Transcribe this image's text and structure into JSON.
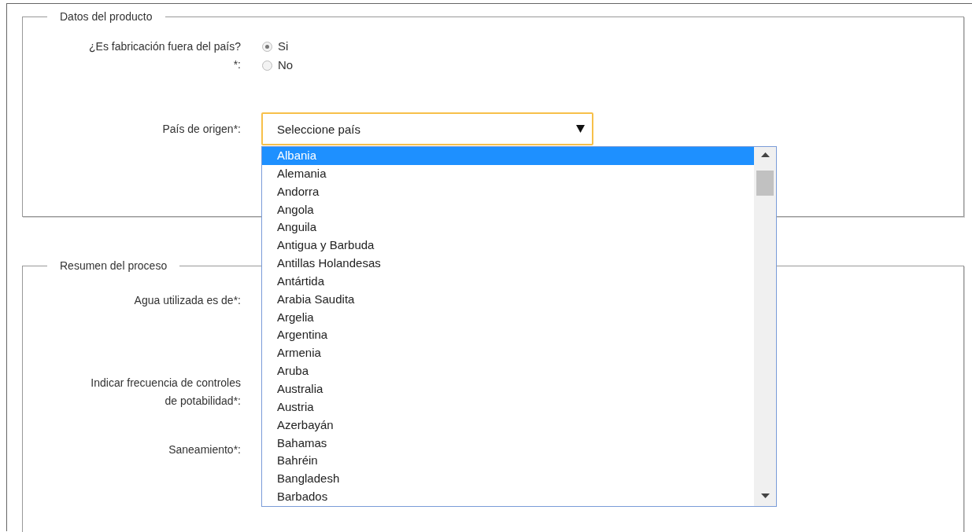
{
  "sections": [
    {
      "legend": "Datos del producto",
      "fields": [
        {
          "kind": "radio",
          "label": "¿Es fabricación fuera del país?*:",
          "options": [
            {
              "label": "Si",
              "selected": true
            },
            {
              "label": "No",
              "selected": false
            }
          ]
        },
        {
          "kind": "select",
          "label": "País de origen*:",
          "value": "Seleccione país",
          "expanded": true,
          "options": [
            {
              "label": "Albania",
              "selected": true
            },
            {
              "label": "Alemania",
              "selected": false
            },
            {
              "label": "Andorra",
              "selected": false
            },
            {
              "label": "Angola",
              "selected": false
            },
            {
              "label": "Anguila",
              "selected": false
            },
            {
              "label": "Antigua y Barbuda",
              "selected": false
            },
            {
              "label": "Antillas Holandesas",
              "selected": false
            },
            {
              "label": "Antártida",
              "selected": false
            },
            {
              "label": "Arabia Saudita",
              "selected": false
            },
            {
              "label": "Argelia",
              "selected": false
            },
            {
              "label": "Argentina",
              "selected": false
            },
            {
              "label": "Armenia",
              "selected": false
            },
            {
              "label": "Aruba",
              "selected": false
            },
            {
              "label": "Australia",
              "selected": false
            },
            {
              "label": "Austria",
              "selected": false
            },
            {
              "label": "Azerbayán",
              "selected": false
            },
            {
              "label": "Bahamas",
              "selected": false
            },
            {
              "label": "Bahréin",
              "selected": false
            },
            {
              "label": "Bangladesh",
              "selected": false
            },
            {
              "label": "Barbados",
              "selected": false
            }
          ]
        }
      ]
    },
    {
      "legend": "Resumen del proceso",
      "fields": [
        {
          "kind": "label",
          "label": "Agua utilizada es de*:"
        },
        {
          "kind": "label",
          "label": "Indicar frecuencia de controles de potabilidad*:"
        },
        {
          "kind": "label",
          "label": "Saneamiento*:"
        }
      ]
    }
  ]
}
